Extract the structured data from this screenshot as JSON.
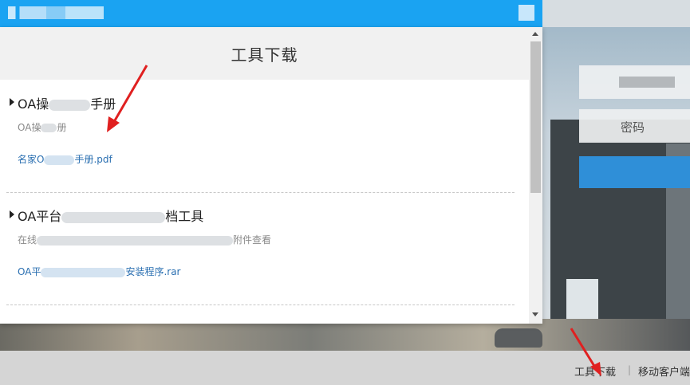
{
  "topbar": {
    "logo_text": ""
  },
  "modal": {
    "title": "工具下载",
    "items": [
      {
        "title_prefix": "OA操",
        "title_suffix": "手册",
        "desc_prefix": "OA操",
        "desc_suffix": "册",
        "link_prefix": "名家O",
        "link_suffix": "手册.pdf"
      },
      {
        "title_prefix": "OA平台",
        "title_suffix": "档工具",
        "desc_prefix": "在线",
        "desc_suffix": "附件查看",
        "link_prefix": "OA平",
        "link_suffix": "安装程序.rar"
      }
    ]
  },
  "login": {
    "field2_text": "密码"
  },
  "footer": {
    "link1": "工具下载",
    "separator": "|",
    "link2": "移动客户端"
  },
  "colors": {
    "topbar": "#1aa3f2",
    "link": "#2a6fb1",
    "arrow": "#e02020"
  }
}
